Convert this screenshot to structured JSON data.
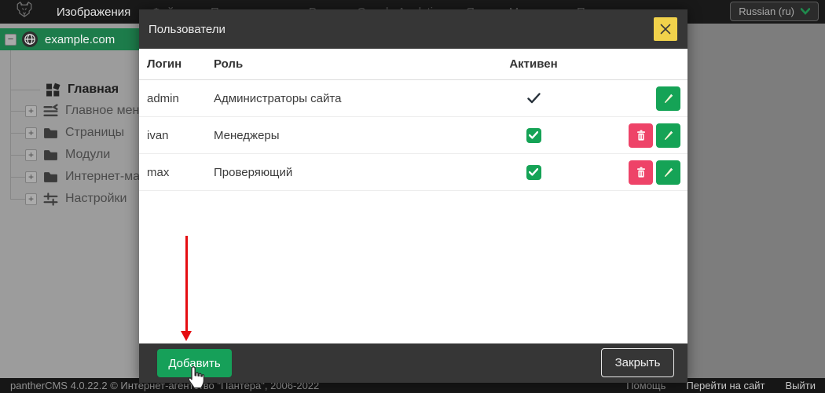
{
  "nav": {
    "items": [
      {
        "label": "Изображения",
        "active": true
      },
      {
        "label": "Файлы",
        "active": false
      },
      {
        "label": "Пользователи",
        "active": false
      },
      {
        "label": "Роли",
        "active": false
      },
      {
        "label": "Google Analytics",
        "active": false
      },
      {
        "label": "Яндекс.Метрика",
        "active": false
      },
      {
        "label": "Помощники",
        "active": false
      }
    ],
    "language": {
      "label": "Russian (ru)",
      "chevron_color": "#1f8a4d"
    }
  },
  "sidebar": {
    "site_name": "example.com",
    "collapse_sign": "−",
    "expand_sign": "+",
    "items": [
      {
        "label": "Главная",
        "icon": "blocks-icon",
        "active": true,
        "expandable": false
      },
      {
        "label": "Главное меню",
        "icon": "menu-fold-icon",
        "active": false,
        "expandable": true
      },
      {
        "label": "Страницы",
        "icon": "folder-icon",
        "active": false,
        "expandable": true
      },
      {
        "label": "Модули",
        "icon": "folder-icon",
        "active": false,
        "expandable": true
      },
      {
        "label": "Интернет-магазин",
        "icon": "folder-icon",
        "active": false,
        "expandable": true
      },
      {
        "label": "Настройки",
        "icon": "sliders-icon",
        "active": false,
        "expandable": true
      }
    ]
  },
  "modal": {
    "title": "Пользователи",
    "table": {
      "headers": [
        "Логин",
        "Роль",
        "Активен"
      ],
      "rows": [
        {
          "login": "admin",
          "role": "Администраторы сайта",
          "active": true,
          "active_style": "plain-check",
          "deletable": false
        },
        {
          "login": "ivan",
          "role": "Менеджеры",
          "active": true,
          "active_style": "checkbox",
          "deletable": true
        },
        {
          "login": "max",
          "role": "Проверяющий",
          "active": true,
          "active_style": "checkbox",
          "deletable": true
        }
      ]
    },
    "buttons": {
      "add": "Добавить",
      "close": "Закрыть"
    }
  },
  "footer": {
    "copyright": "pantherCMS 4.0.22.2 © Интернет-агентство \"Пантера\", 2006-2022",
    "links": [
      "Помощь",
      "Перейти на сайт",
      "Выйти"
    ]
  },
  "colors": {
    "accent_green": "#16a059",
    "delete_pink": "#ee4368",
    "close_yellow": "#f1d24b",
    "arrow_red": "#e50d12",
    "site_row_green": "#1d7c4b"
  }
}
